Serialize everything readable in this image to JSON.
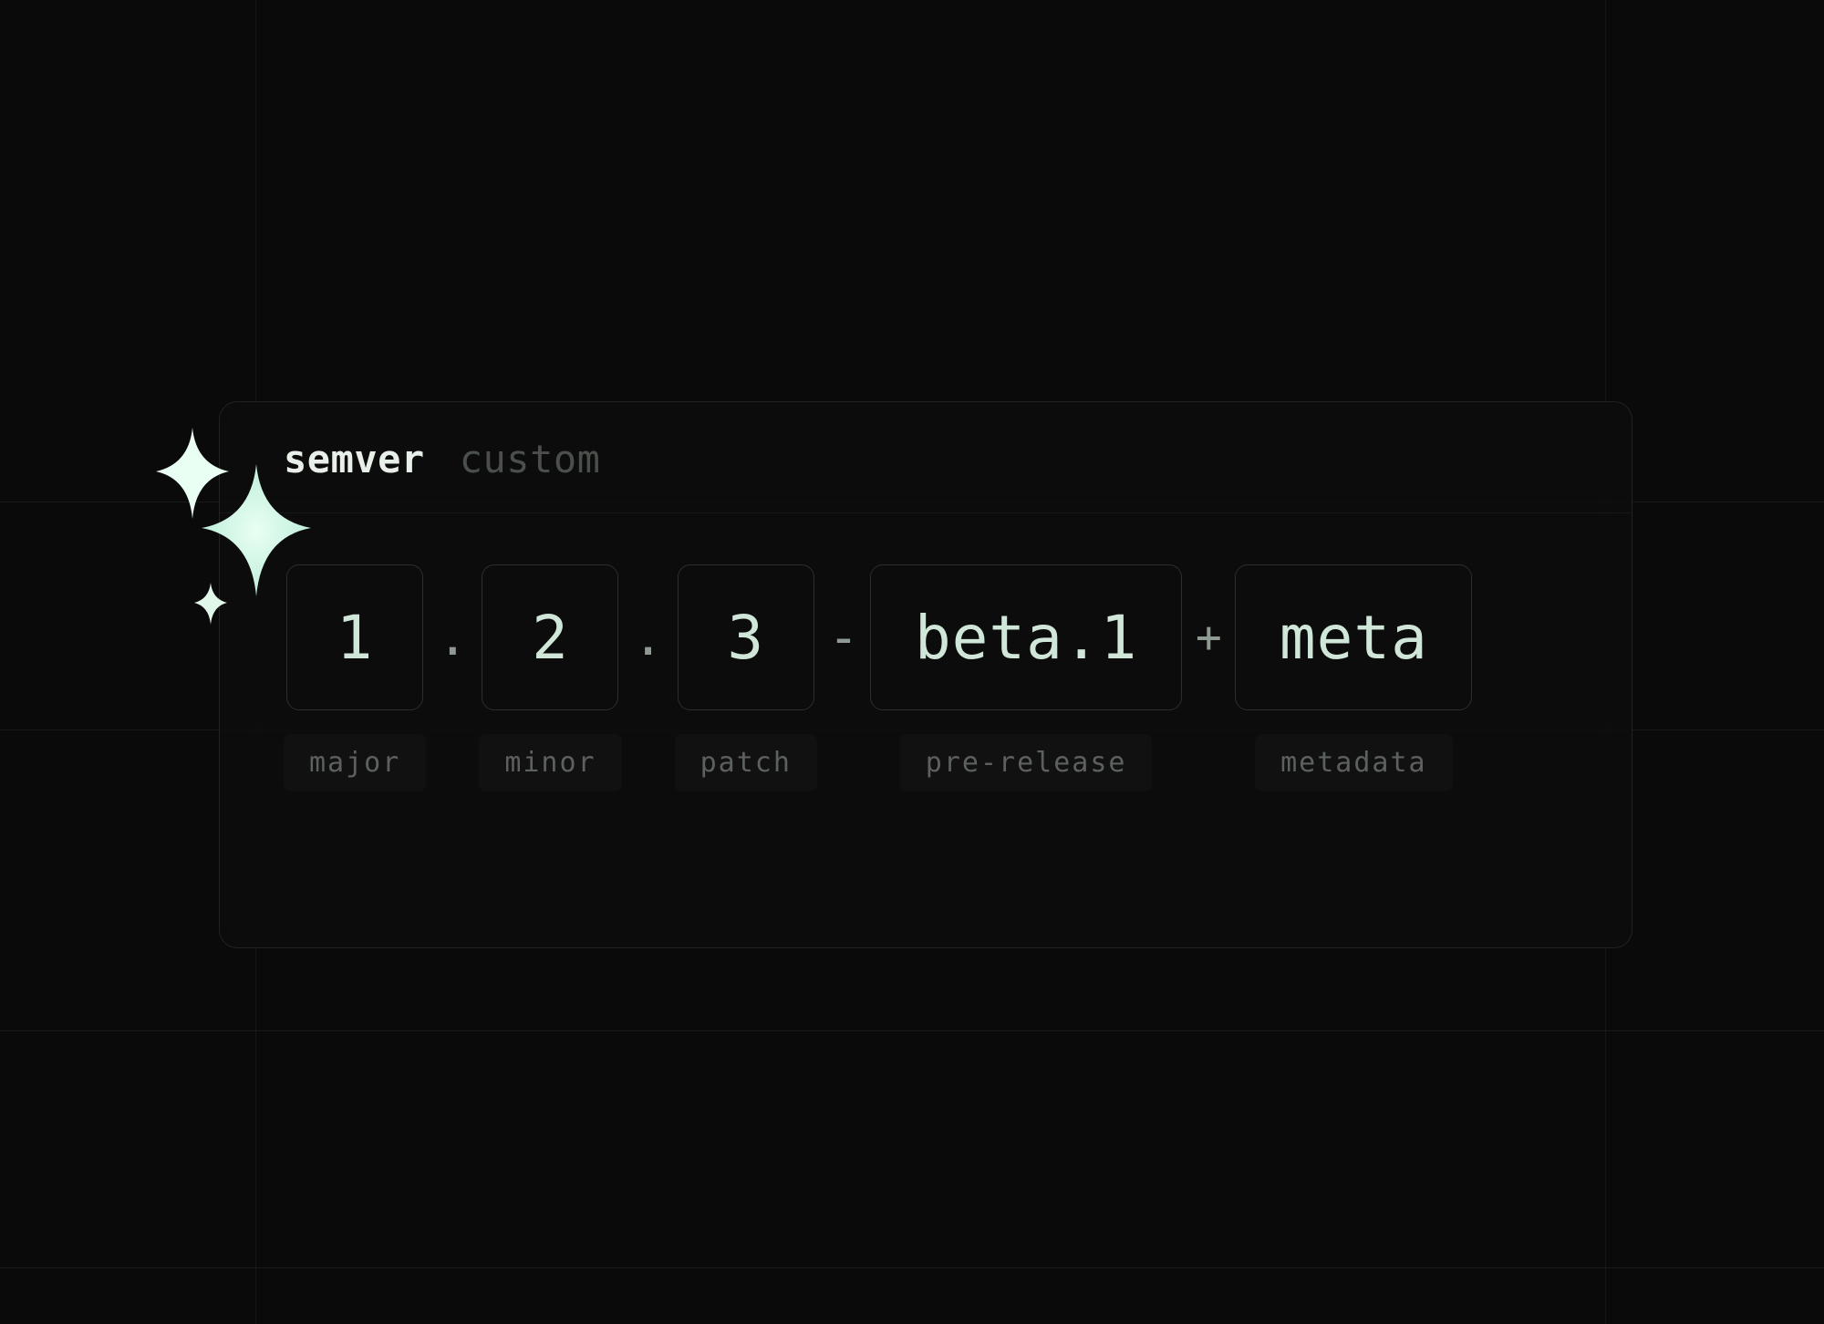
{
  "tabs": {
    "semver": "semver",
    "custom": "custom",
    "active": "semver"
  },
  "segments": {
    "major": {
      "value": "1",
      "label": "major"
    },
    "minor": {
      "value": "2",
      "label": "minor"
    },
    "patch": {
      "value": "3",
      "label": "patch"
    },
    "prerelease": {
      "value": "beta.1",
      "label": "pre-release"
    },
    "metadata": {
      "value": "meta",
      "label": "metadata"
    }
  },
  "separators": {
    "dot": ".",
    "dash": "-",
    "plus": "+"
  },
  "icons": {
    "sparkles": "sparkles-icon"
  },
  "colors": {
    "bg": "#0a0a0a",
    "text_primary": "#cfe6d8",
    "text_muted": "#5c615e",
    "border": "rgba(255,255,255,0.12)"
  }
}
